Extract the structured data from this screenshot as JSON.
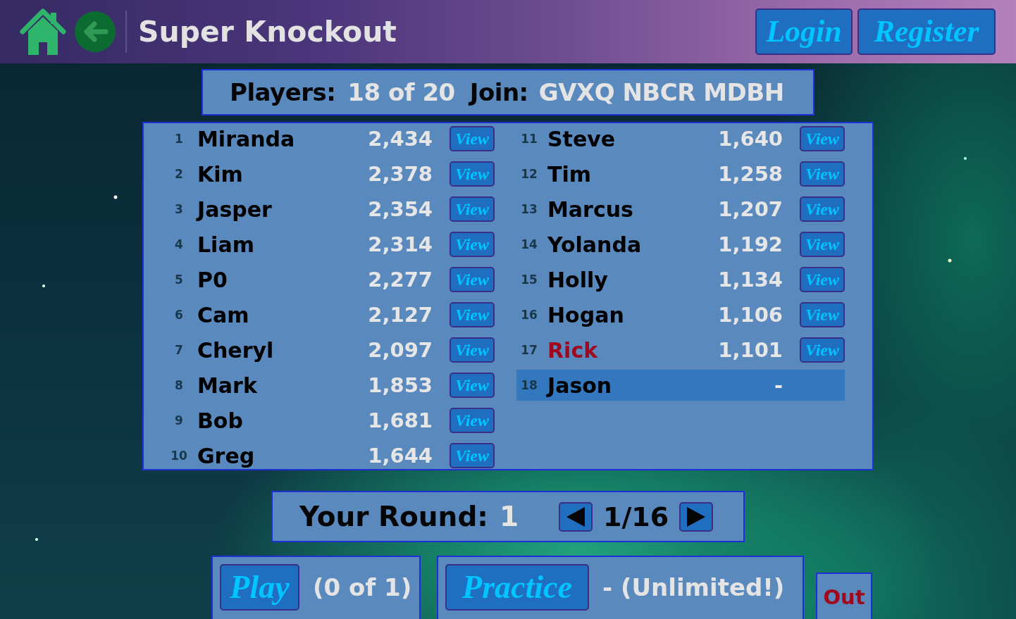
{
  "header": {
    "title": "Super Knockout",
    "buttons": [
      "Login",
      "Register"
    ]
  },
  "summary": {
    "players_label": "Players:",
    "players_count": "18 of 20",
    "join_label": "Join:",
    "join_code": "GVXQ NBCR MDBH"
  },
  "players": [
    {
      "rank": "1",
      "name": "Miranda",
      "score": "2,434",
      "action": "View",
      "color": "#000000",
      "selected": false
    },
    {
      "rank": "2",
      "name": "Kim",
      "score": "2,378",
      "action": "View",
      "color": "#000000",
      "selected": false
    },
    {
      "rank": "3",
      "name": "Jasper",
      "score": "2,354",
      "action": "View",
      "color": "#000000",
      "selected": false
    },
    {
      "rank": "4",
      "name": "Liam",
      "score": "2,314",
      "action": "View",
      "color": "#000000",
      "selected": false
    },
    {
      "rank": "5",
      "name": "P0",
      "score": "2,277",
      "action": "View",
      "color": "#000000",
      "selected": false
    },
    {
      "rank": "6",
      "name": "Cam",
      "score": "2,127",
      "action": "View",
      "color": "#000000",
      "selected": false
    },
    {
      "rank": "7",
      "name": "Cheryl",
      "score": "2,097",
      "action": "View",
      "color": "#000000",
      "selected": false
    },
    {
      "rank": "8",
      "name": "Mark",
      "score": "1,853",
      "action": "View",
      "color": "#000000",
      "selected": false
    },
    {
      "rank": "9",
      "name": "Bob",
      "score": "1,681",
      "action": "View",
      "color": "#000000",
      "selected": false
    },
    {
      "rank": "10",
      "name": "Greg",
      "score": "1,644",
      "action": "View",
      "color": "#000000",
      "selected": false
    },
    {
      "rank": "11",
      "name": "Steve",
      "score": "1,640",
      "action": "View",
      "color": "#000000",
      "selected": false
    },
    {
      "rank": "12",
      "name": "Tim",
      "score": "1,258",
      "action": "View",
      "color": "#000000",
      "selected": false
    },
    {
      "rank": "13",
      "name": "Marcus",
      "score": "1,207",
      "action": "View",
      "color": "#000000",
      "selected": false
    },
    {
      "rank": "14",
      "name": "Yolanda",
      "score": "1,192",
      "action": "View",
      "color": "#000000",
      "selected": false
    },
    {
      "rank": "15",
      "name": "Holly",
      "score": "1,134",
      "action": "View",
      "color": "#000000",
      "selected": false
    },
    {
      "rank": "16",
      "name": "Hogan",
      "score": "1,106",
      "action": "View",
      "color": "#000000",
      "selected": false
    },
    {
      "rank": "17",
      "name": "Rick",
      "score": "1,101",
      "action": "View",
      "color": "#a0081e",
      "selected": false
    },
    {
      "rank": "18",
      "name": "Jason",
      "score": "-",
      "color": "#000000",
      "selected": true
    }
  ],
  "round": {
    "label": "Your Round:",
    "value": "1",
    "page": "1/16"
  },
  "play": {
    "button": "Play",
    "note": "(0 of 1)"
  },
  "practice": {
    "button": "Practice",
    "note": "- (Unlimited!)"
  },
  "out": "Out"
}
